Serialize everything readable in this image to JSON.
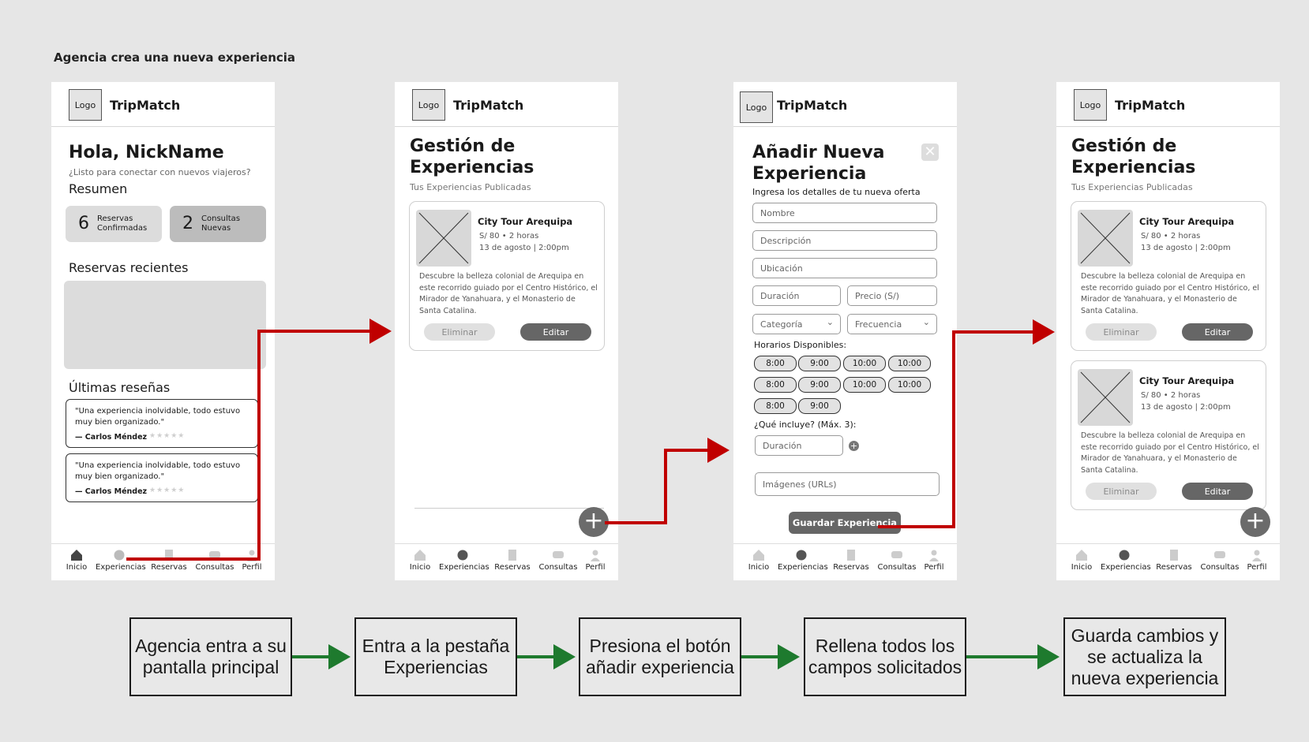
{
  "title": "Agencia crea una nueva experiencia",
  "app": {
    "logo": "Logo",
    "name": "TripMatch"
  },
  "nav": [
    "Inicio",
    "Experiencias",
    "Reservas",
    "Consultas",
    "Perfil"
  ],
  "home": {
    "greeting": "Hola, NickName",
    "subtitle": "¿Listo para conectar con nuevos viajeros?",
    "summary": "Resumen",
    "stats": [
      {
        "value": "6",
        "label_1": "Reservas",
        "label_2": "Confirmadas"
      },
      {
        "value": "2",
        "label_1": "Consultas",
        "label_2": "Nuevas"
      }
    ],
    "recent": "Reservas recientes",
    "reviews_title": "Últimas reseñas",
    "reviews": [
      {
        "text": "\"Una experiencia inolvidable, todo estuvo muy bien organizado.\"",
        "author": "— Carlos Méndez",
        "stars": "★★★★★"
      },
      {
        "text": "\"Una experiencia inolvidable, todo estuvo muy bien organizado.\"",
        "author": "— Carlos Méndez",
        "stars": "★★★★★"
      }
    ]
  },
  "manage": {
    "title_1": "Gestión de",
    "title_2": "Experiencias",
    "subtitle": "Tus Experiencias Publicadas",
    "card": {
      "name": "City Tour Arequipa",
      "meta_1": "S/ 80 • 2 horas",
      "meta_2": "13 de agosto | 2:00pm",
      "description": "Descubre la belleza colonial de Arequipa en este recorrido guiado por el Centro Histórico, el Mirador de Yanahuara, y el Monasterio de Santa Catalina.",
      "delete": "Eliminar",
      "edit": "Editar"
    },
    "fab": "+"
  },
  "form": {
    "title_1": "Añadir Nueva",
    "title_2": "Experiencia",
    "subtitle": "Ingresa los detalles de tu nueva oferta",
    "fields": {
      "name": "Nombre",
      "description": "Descripción",
      "location": "Ubicación",
      "duration": "Duración",
      "price": "Precio (S/)",
      "category": "Categoría",
      "frequency": "Frecuencia",
      "includes_field": "Duración",
      "images": "Imágenes (URLs)"
    },
    "schedules_label": "Horarios Disponibles:",
    "schedules": [
      "8:00",
      "9:00",
      "10:00",
      "10:00",
      "8:00",
      "9:00",
      "10:00",
      "10:00",
      "8:00",
      "9:00"
    ],
    "includes_label": "¿Qué incluye? (Máx. 3):",
    "save": "Guardar Experiencia"
  },
  "steps": [
    "Agencia entra a su pantalla principal",
    "Entra a la pestaña Experiencias",
    "Presiona el botón añadir experiencia",
    "Rellena todos los campos solicitados",
    "Guarda cambios y se actualiza la nueva experiencia"
  ],
  "colors": {
    "flow_red": "#c00000",
    "flow_green": "#1e7a2e",
    "accent_dark": "#666666"
  }
}
